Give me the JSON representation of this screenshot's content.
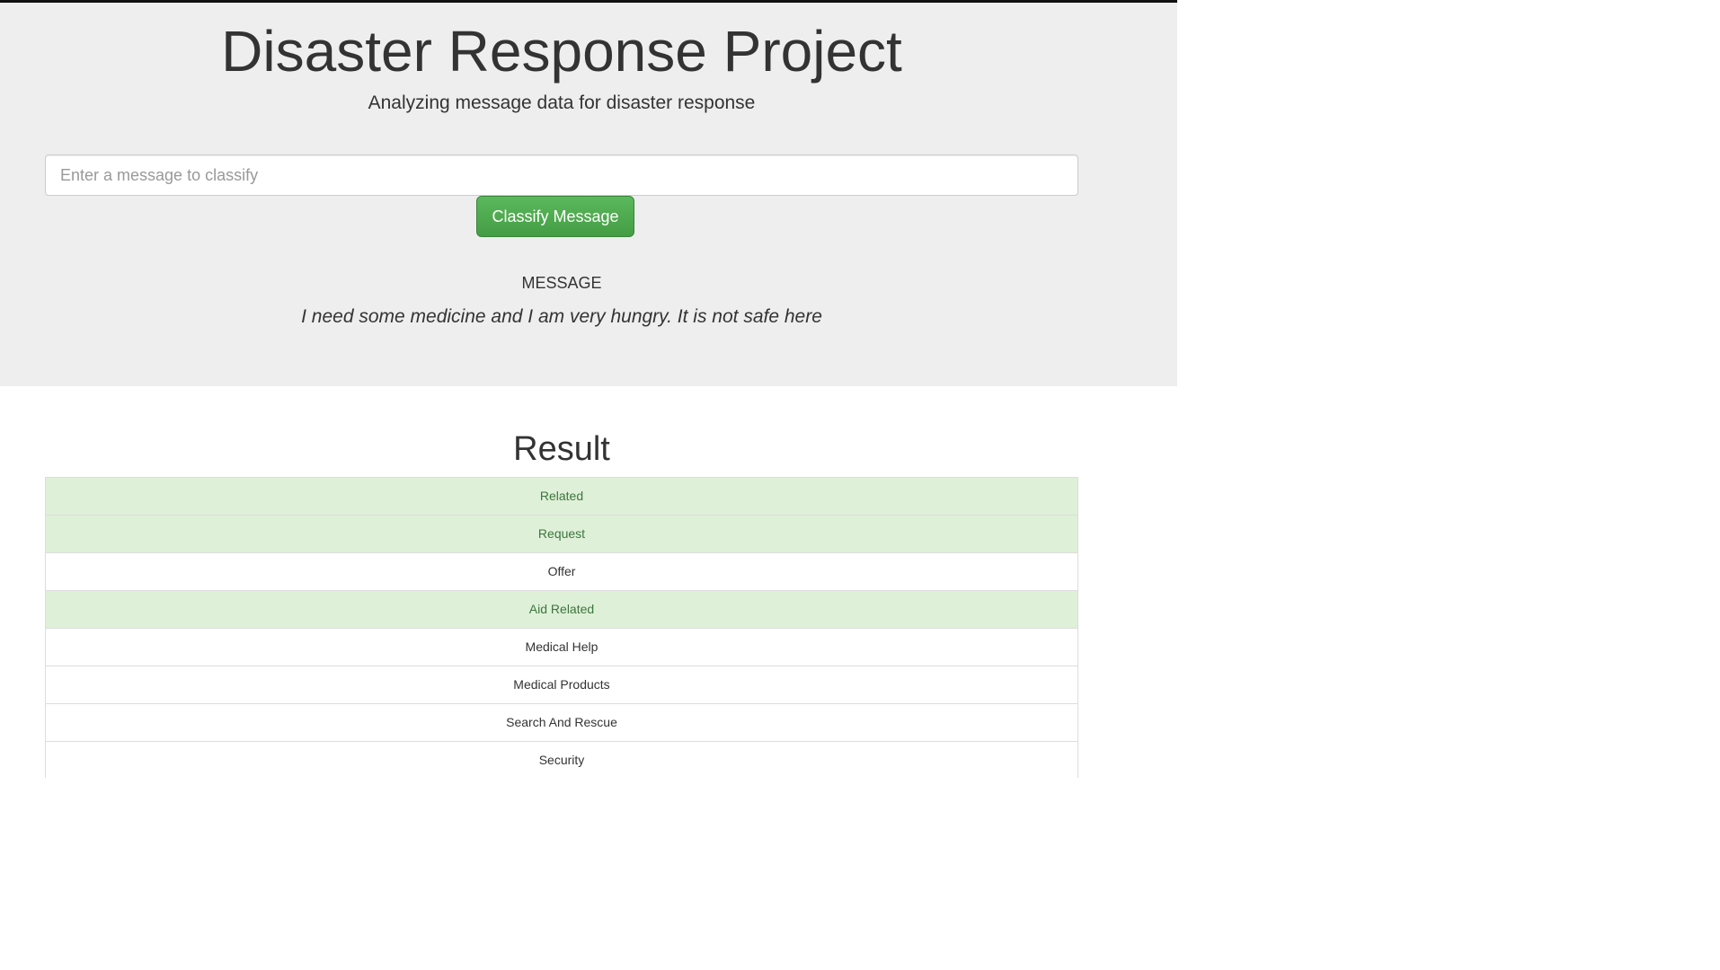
{
  "header": {
    "title": "Disaster Response Project",
    "subtitle": "Analyzing message data for disaster response"
  },
  "form": {
    "input_placeholder": "Enter a message to classify",
    "input_value": "",
    "submit_label": "Classify Message"
  },
  "message": {
    "heading": "MESSAGE",
    "text": "I need some medicine and I am very hungry. It is not safe here"
  },
  "result": {
    "title": "Result",
    "items": [
      {
        "label": "Related",
        "active": true
      },
      {
        "label": "Request",
        "active": true
      },
      {
        "label": "Offer",
        "active": false
      },
      {
        "label": "Aid Related",
        "active": true
      },
      {
        "label": "Medical Help",
        "active": false
      },
      {
        "label": "Medical Products",
        "active": false
      },
      {
        "label": "Search And Rescue",
        "active": false
      },
      {
        "label": "Security",
        "active": false
      },
      {
        "label": "",
        "active": false
      }
    ]
  },
  "colors": {
    "jumbotron_bg": "#eeeeee",
    "button_green": "#5cb85c",
    "positive_row_bg": "#dff0d8",
    "positive_row_text": "#3c763d"
  }
}
